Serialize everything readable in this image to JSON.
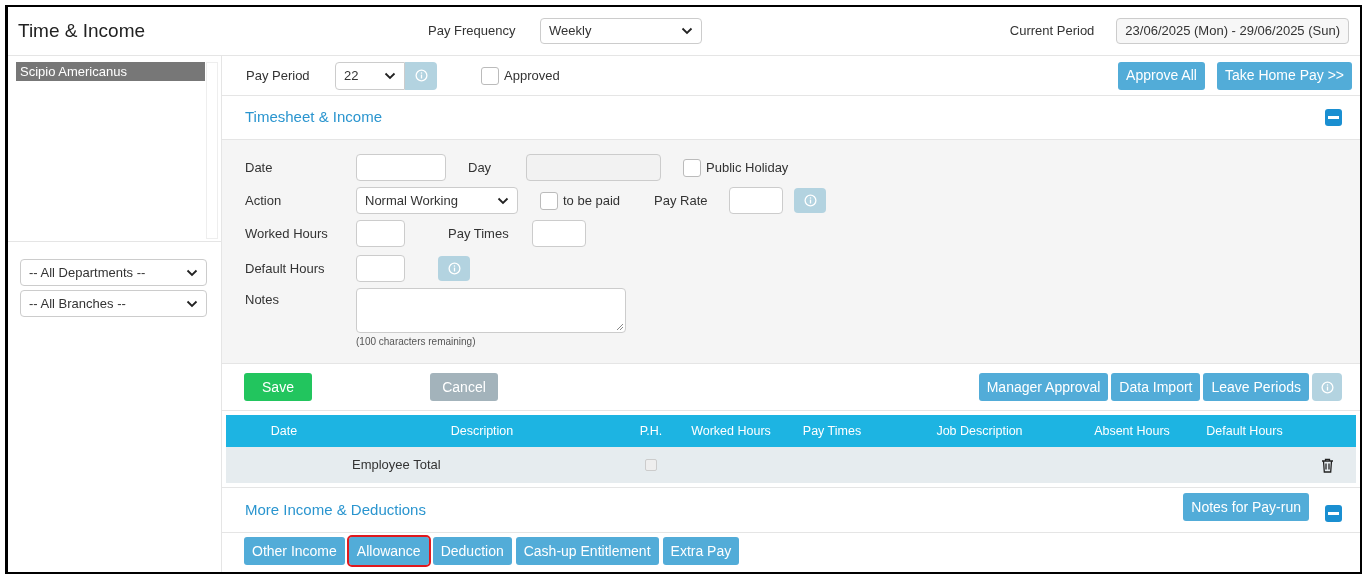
{
  "header": {
    "title": "Time & Income",
    "pay_frequency": {
      "label": "Pay Frequency",
      "value": "Weekly"
    },
    "current_period": {
      "label": "Current Period",
      "value": "23/06/2025 (Mon) - 29/06/2025 (Sun)"
    }
  },
  "sidebar": {
    "employees": [
      {
        "name": "Scipio Americanus",
        "selected": true
      }
    ],
    "filters": [
      "-- All Departments --",
      "-- All Branches --"
    ]
  },
  "pay_period": {
    "label": "Pay Period",
    "value": "22",
    "approved": {
      "label": "Approved",
      "checked": false
    },
    "actions": [
      "Approve All",
      "Take Home Pay >>"
    ]
  },
  "timesheet": {
    "title": "Timesheet & Income",
    "expanded": true,
    "date": {
      "label": "Date"
    },
    "day": {
      "label": "Day",
      "disabled": true
    },
    "public_holiday": {
      "label": "Public Holiday",
      "checked": false
    },
    "action": {
      "label": "Action",
      "value": "Normal Working"
    },
    "to_be_paid": {
      "label": "to be paid",
      "checked": false
    },
    "pay_rate": {
      "label": "Pay Rate"
    },
    "worked_hours": {
      "label": "Worked Hours"
    },
    "pay_times": {
      "label": "Pay Times"
    },
    "default_hours": {
      "label": "Default Hours"
    },
    "notes": {
      "label": "Notes",
      "hint": "(100 characters remaining)"
    },
    "buttons": [
      {
        "label": "Save",
        "kind": "save"
      },
      {
        "label": "Cancel",
        "kind": "cancel"
      }
    ],
    "tools": [
      "Manager Approval",
      "Data Import",
      "Leave Periods"
    ]
  },
  "table": {
    "columns": [
      "Date",
      "Description",
      "P.H.",
      "Worked Hours",
      "Pay Times",
      "Job Description",
      "Absent Hours",
      "Default Hours"
    ],
    "rows": [
      {
        "description": "Employee Total",
        "ph_checked": false
      }
    ]
  },
  "more": {
    "title": "More Income & Deductions",
    "expanded": true,
    "notes_button": "Notes for Pay-run",
    "tabs": [
      {
        "label": "Other Income",
        "highlighted": false
      },
      {
        "label": "Allowance",
        "highlighted": true
      },
      {
        "label": "Deduction",
        "highlighted": false
      },
      {
        "label": "Cash-up Entitlement",
        "highlighted": false
      },
      {
        "label": "Extra Pay",
        "highlighted": false
      }
    ]
  }
}
